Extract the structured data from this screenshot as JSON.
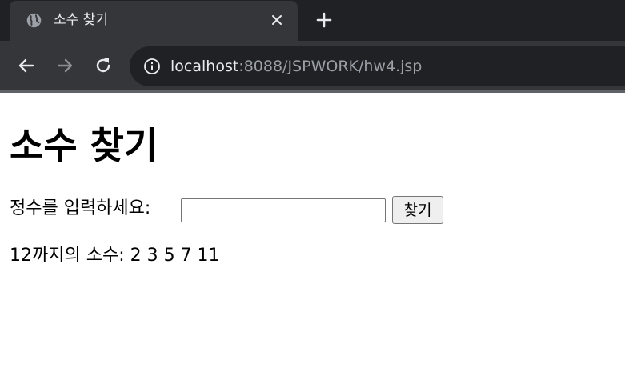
{
  "browser": {
    "tab_title": "소수 찾기",
    "url_host": "localhost",
    "url_rest": ":8088/JSPWORK/hw4.jsp"
  },
  "page": {
    "heading": "소수 찾기",
    "input_label": "정수를 입력하세요:",
    "input_value": "",
    "submit_label": "찾기",
    "result_text": "12까지의 소수: 2 3 5 7 11"
  }
}
